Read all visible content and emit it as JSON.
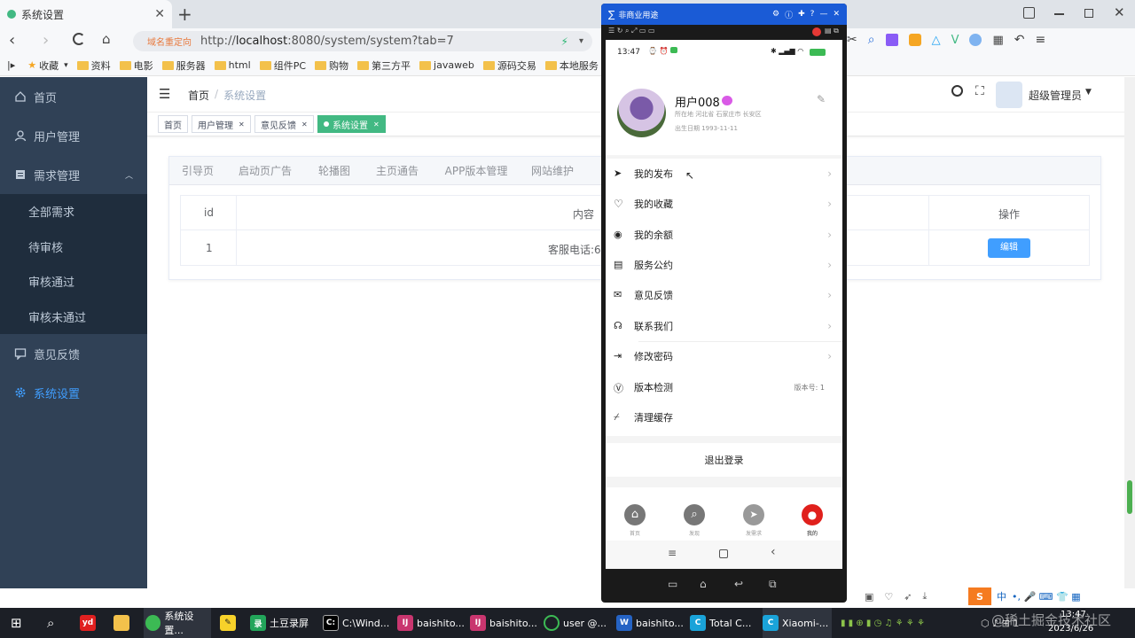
{
  "browser": {
    "tab_title": "系统设置",
    "redirect_label": "域名重定向",
    "url_prefix": "http://",
    "url_host": "localhost",
    "url_rest": ":8080/system/system?tab=7",
    "bookmarks": [
      "收藏",
      "资料",
      "电影",
      "服务器",
      "html",
      "组件PC",
      "购物",
      "第三方平",
      "javaweb",
      "源码交易",
      "本地服务"
    ]
  },
  "sidebar": {
    "items": [
      {
        "label": "首页"
      },
      {
        "label": "用户管理"
      },
      {
        "label": "需求管理"
      },
      {
        "label": "全部需求"
      },
      {
        "label": "待审核"
      },
      {
        "label": "审核通过"
      },
      {
        "label": "审核未通过"
      },
      {
        "label": "意见反馈"
      },
      {
        "label": "系统设置"
      }
    ],
    "active_color": "#409eff"
  },
  "header": {
    "breadcrumb_home": "首页",
    "breadcrumb_sep": "/",
    "breadcrumb_current": "系统设置",
    "user_name": "超级管理员"
  },
  "tags": [
    "首页",
    "用户管理",
    "意见反馈",
    "系统设置"
  ],
  "content": {
    "tabs": [
      "引导页",
      "启动页广告",
      "轮播图",
      "主页通告",
      "APP版本管理",
      "网站维护"
    ],
    "table": {
      "headers": {
        "id": "id",
        "content": "内容",
        "ops": "操作"
      },
      "rows": [
        {
          "id": "1",
          "content": "客服电话:66",
          "action": "编辑"
        }
      ]
    }
  },
  "phone": {
    "window_title": "非商业用途",
    "time": "13:47",
    "user_name": "用户008",
    "location": "所在地  河北省  石家庄市  长安区",
    "birthday": "出生日期  1993-11-11",
    "menu": [
      {
        "label": "我的发布",
        "icon": "send-icon"
      },
      {
        "label": "我的收藏",
        "icon": "heart-icon"
      },
      {
        "label": "我的余额",
        "icon": "wallet-icon"
      },
      {
        "label": "服务公约",
        "icon": "document-icon"
      },
      {
        "label": "意见反馈",
        "icon": "mail-icon"
      },
      {
        "label": "联系我们",
        "icon": "headset-icon"
      },
      {
        "label": "修改密码",
        "icon": "logout-icon"
      },
      {
        "label": "版本检测",
        "icon": "version-icon",
        "extra": "版本号: 1"
      },
      {
        "label": "清理缓存",
        "icon": "broom-icon"
      }
    ],
    "logout": "退出登录",
    "bottom_nav": [
      "首页",
      "发现",
      "发需求",
      "我的"
    ]
  },
  "taskbar": {
    "apps": [
      "系统设置...",
      "土豆录屏",
      "C:\\Wind...",
      "baishito...",
      "baishito...",
      "user @...",
      "baishito...",
      "Total C...",
      "Xiaomi-..."
    ],
    "time": "13:47",
    "date": "2023/6/26",
    "ime": "中",
    "watermark": "@稀土掘金技术社区"
  }
}
